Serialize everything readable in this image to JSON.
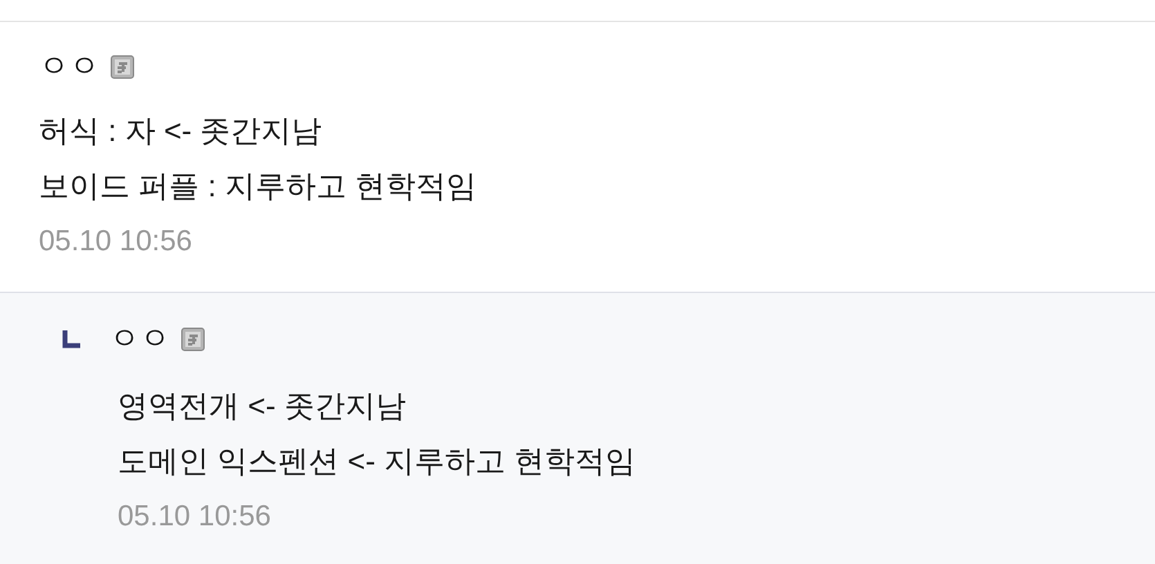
{
  "comments": [
    {
      "kind": "comment",
      "author": "ㅇㅇ",
      "lines": [
        "허식 : 자 <- 좃간지남",
        "보이드 퍼플 : 지루하고 현학적임"
      ],
      "time": "05.10 10:56"
    },
    {
      "kind": "reply",
      "author": "ㅇㅇ",
      "lines": [
        "영역전개 <- 좃간지남",
        "도메인 익스펜션 <- 지루하고 현학적임"
      ],
      "time": "05.10 10:56"
    }
  ]
}
